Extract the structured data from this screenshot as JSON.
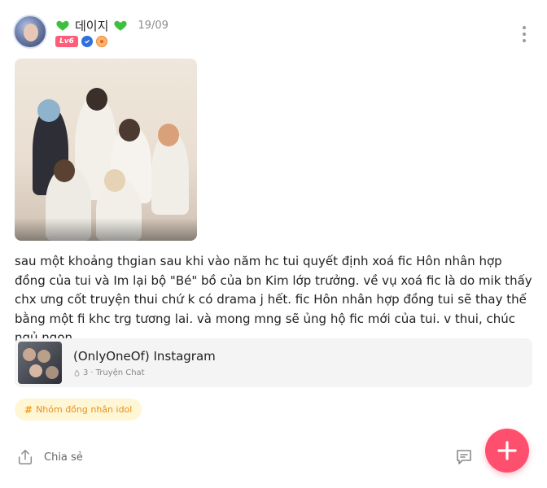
{
  "post": {
    "username": "데이지",
    "date": "19/09",
    "level": "Lv6",
    "heart_color": "#3fbf3f",
    "body": "sau một khoảng thgian sau khi vào năm hc tui quyết định xoá fic Hôn nhân hợp đồng của tui và Im lại bộ \"Bé\" bồ của bn Kim lớp trưởng. về vụ xoá fic là do mik thấy chx ưng cốt truyện thui chứ k có drama j hết. fic Hôn nhân hợp đồng tui sẽ thay thế bằng một fi khc trg tương lai. và mong mng sẽ ủng hộ fic mới của tui. v thui, chúc ngủ ngon."
  },
  "linked_story": {
    "title": "(OnlyOneOf) Instagram",
    "count": "3",
    "category": "Truyện Chat"
  },
  "tag": {
    "symbol": "#",
    "label": "Nhóm đồng nhân idol"
  },
  "actions": {
    "share_label": "Chia sẻ"
  },
  "colors": {
    "accent": "#ff4f6e",
    "tag_bg": "#fff6d6",
    "tag_text": "#e8901a"
  },
  "icons": [
    "more-vertical-icon",
    "share-icon",
    "comment-icon",
    "plus-icon",
    "fire-icon",
    "heart-icon"
  ]
}
